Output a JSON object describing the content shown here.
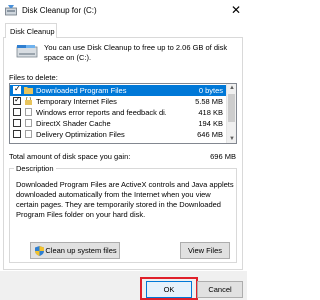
{
  "window": {
    "title": "Disk Cleanup for  (C:)",
    "close_glyph": "✕"
  },
  "tab": {
    "label": "Disk Cleanup"
  },
  "intro_text": "You can use Disk Cleanup to free up to 2.06 GB of disk space on  (C:).",
  "files_to_delete": {
    "label": "Files to delete:",
    "items": [
      {
        "name": "Downloaded Program Files",
        "size": "0 bytes",
        "checked": true,
        "selected": true
      },
      {
        "name": "Temporary Internet Files",
        "size": "5.58 MB",
        "checked": true,
        "selected": false
      },
      {
        "name": "Windows error reports and feedback di...",
        "size": "418 KB",
        "checked": false,
        "selected": false
      },
      {
        "name": "DirectX Shader Cache",
        "size": "194 KB",
        "checked": false,
        "selected": false
      },
      {
        "name": "Delivery Optimization Files",
        "size": "646 MB",
        "checked": false,
        "selected": false
      }
    ]
  },
  "total": {
    "label": "Total amount of disk space you gain:",
    "value": "696 MB"
  },
  "description": {
    "title": "Description",
    "text": "Downloaded Program Files are ActiveX controls and Java applets downloaded automatically from the Internet when you view certain pages. They are temporarily stored in the Downloaded Program Files folder on your hard disk."
  },
  "buttons": {
    "clean_system": "Clean up system files",
    "view_files": "View Files",
    "ok": "OK",
    "cancel": "Cancel"
  },
  "colors": {
    "selection": "#0078d7",
    "highlight_box": "#e0202a"
  },
  "icons": {
    "title": "disk-cleanup-icon",
    "drive": "drive-icon",
    "shield": "uac-shield-icon"
  }
}
